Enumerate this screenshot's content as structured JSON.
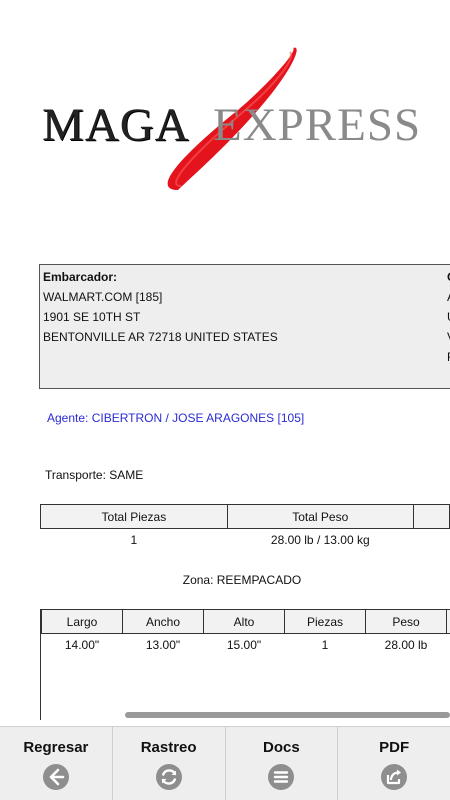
{
  "logo": {
    "word1": "MAGA",
    "word2": "EXPRESS",
    "accent_color": "#e3141c"
  },
  "shipper": {
    "title": "Embarcador:",
    "lines": [
      "WALMART.COM [185]",
      "1901 SE 10TH ST",
      "BENTONVILLE AR 72718 UNITED STATES"
    ]
  },
  "consignee_partial": {
    "title": "C",
    "lines": [
      "A",
      "U",
      "V",
      "F"
    ]
  },
  "agent": "Agente: CIBERTRON / JOSE ARAGONES [105]",
  "transport": "Transporte: SAME",
  "totals": {
    "headers": [
      "Total Piezas",
      "Total Peso"
    ],
    "values": [
      "1",
      "28.00 lb / 13.00 kg"
    ]
  },
  "zone": "Zona: REEMPACADO",
  "pieces": {
    "headers": [
      "Largo",
      "Ancho",
      "Alto",
      "Piezas",
      "Peso"
    ],
    "rows": [
      [
        "14.00\"",
        "13.00\"",
        "15.00\"",
        "1",
        "28.00 lb"
      ]
    ]
  },
  "toolbar": {
    "back": "Regresar",
    "track": "Rastreo",
    "docs": "Docs",
    "pdf": "PDF"
  },
  "colors": {
    "icon_gray": "#8e8e8e",
    "agent_blue": "#2a2ad6"
  }
}
